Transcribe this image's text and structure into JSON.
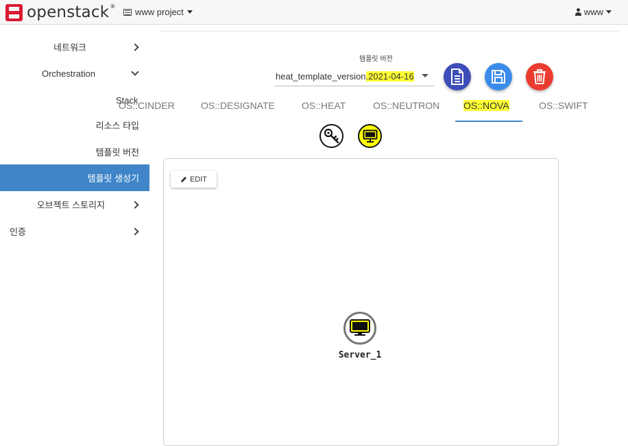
{
  "topbar": {
    "brand": "openstack",
    "brand_mark": "®",
    "project_label": "www project",
    "user_label": "www"
  },
  "sidebar": {
    "items": [
      {
        "label": "네트워크",
        "chevron": "right"
      },
      {
        "label": "Orchestration",
        "chevron": "down"
      },
      {
        "label": "Stack"
      },
      {
        "label": "리소스 타입"
      },
      {
        "label": "템플릿 버전"
      },
      {
        "label": "템플릿 생성기",
        "active": true
      },
      {
        "label": "오브젝트 스토리지",
        "chevron": "right"
      },
      {
        "label": "인증",
        "chevron": "right"
      }
    ]
  },
  "template_version": {
    "label": "템플릿 버전",
    "value_prefix": "heat_template_version",
    "value_highlight": ".2021-04-16"
  },
  "actions": {
    "icons": [
      "document-icon",
      "save-icon",
      "trash-icon"
    ],
    "colors": {
      "document": "#3d4eb8",
      "save": "#3b8bea",
      "delete": "#ea3c2f"
    }
  },
  "tabs": [
    {
      "label": "OS::CINDER"
    },
    {
      "label": "OS::DESIGNATE"
    },
    {
      "label": "OS::HEAT"
    },
    {
      "label": "OS::NEUTRON"
    },
    {
      "label": "OS::NOVA",
      "active": true
    },
    {
      "label": "OS::SWIFT"
    }
  ],
  "resource_icons": [
    "key-icon",
    "server-icon"
  ],
  "canvas": {
    "edit_label": "EDIT",
    "node_label": "Server_1"
  },
  "colors": {
    "accent": "#3f85c8",
    "highlight": "#ffff33",
    "brand": "#da1a32"
  }
}
